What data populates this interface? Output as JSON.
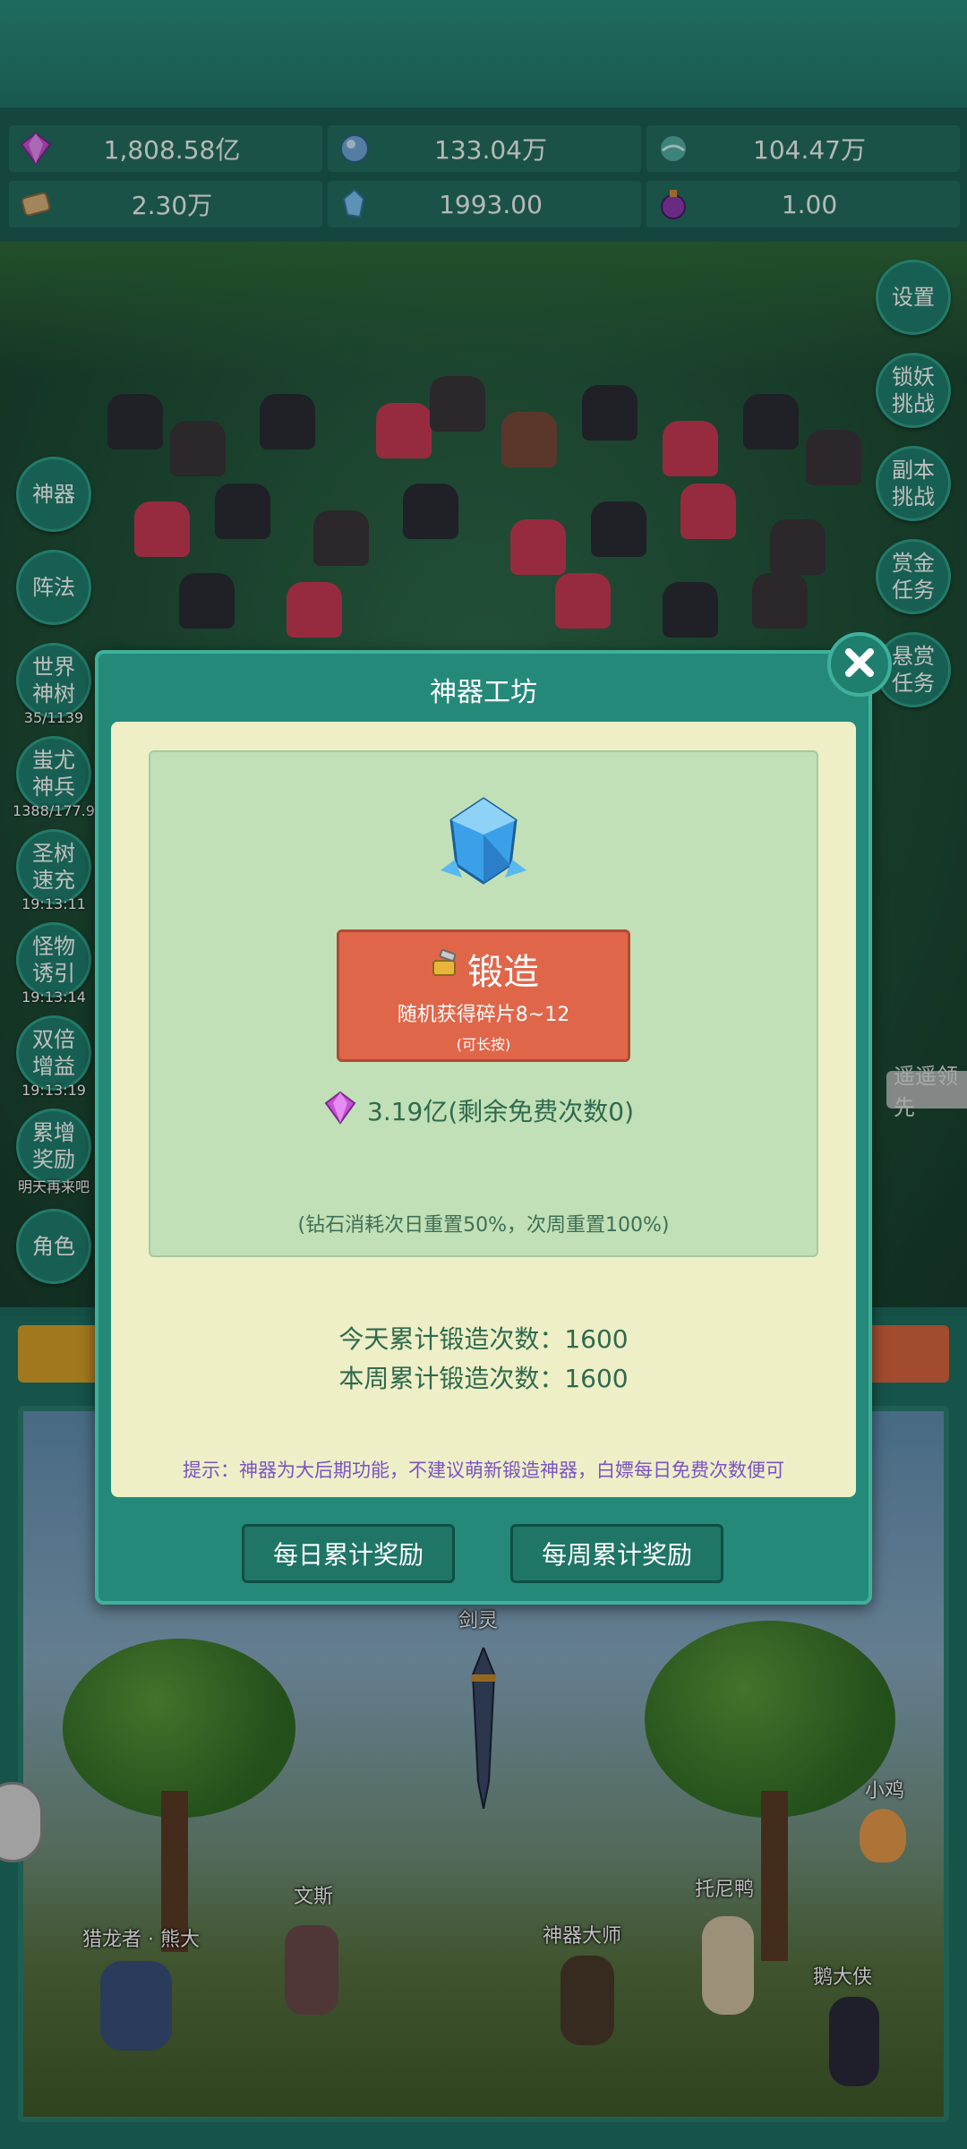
{
  "resources": [
    {
      "icon": "purple-gem-icon",
      "value": "1,808.58亿"
    },
    {
      "icon": "blue-crystal-icon",
      "value": "133.04万"
    },
    {
      "icon": "teal-orb-icon",
      "value": "104.47万"
    },
    {
      "icon": "scroll-icon",
      "value": "2.30万"
    },
    {
      "icon": "ice-shard-icon",
      "value": "1993.00"
    },
    {
      "icon": "purple-potion-icon",
      "value": "1.00"
    }
  ],
  "left_menu": [
    {
      "label": "神器",
      "sub": ""
    },
    {
      "label": "阵法",
      "sub": ""
    },
    {
      "label": "世界神树",
      "sub": "35/1139"
    },
    {
      "label": "蚩尤神兵",
      "sub": "1388/177.9"
    },
    {
      "label": "圣树速充",
      "sub": "19:13:11"
    },
    {
      "label": "怪物诱引",
      "sub": "19:13:14"
    },
    {
      "label": "双倍增益",
      "sub": "19:13:19"
    },
    {
      "label": "累增奖励",
      "sub": "明天再来吧"
    },
    {
      "label": "角色",
      "sub": ""
    }
  ],
  "right_menu": [
    {
      "label": "设置"
    },
    {
      "label": "锁妖挑战"
    },
    {
      "label": "副本挑战"
    },
    {
      "label": "赏金任务"
    },
    {
      "label": "悬赏任务"
    }
  ],
  "lead_tag": "遥遥领先",
  "dialog": {
    "title": "神器工坊",
    "forge": {
      "title": "锻造",
      "subtitle": "随机获得碎片8~12",
      "hint": "(可长按)"
    },
    "cost": "3.19亿(剩余免费次数0)",
    "reset_note": "(钻石消耗次日重置50%，次周重置100%)",
    "today_count": "今天累计锻造次数：1600",
    "week_count": "本周累计锻造次数：1600",
    "tip": "提示：神器为大后期功能，不建议萌新锻造神器，白嫖每日免费次数便可",
    "daily_reward_button": "每日累计奖励",
    "weekly_reward_button": "每周累计奖励"
  },
  "characters": [
    {
      "name": "剑灵"
    },
    {
      "name": "小鸡"
    },
    {
      "name": "文斯"
    },
    {
      "name": "托尼鸭"
    },
    {
      "name": "猎龙者 · 熊大"
    },
    {
      "name": "神器大师"
    },
    {
      "name": "鹅大侠"
    }
  ],
  "colors": {
    "accent": "#25897a",
    "forge_button": "#e0664a",
    "panel": "#c1e0b7",
    "tip_text": "#7b53c4"
  }
}
